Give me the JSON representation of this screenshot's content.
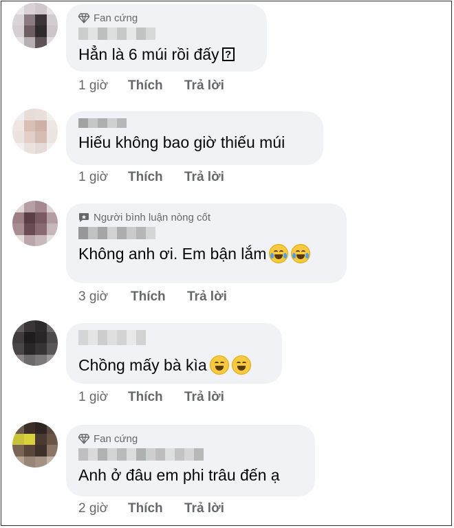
{
  "comments": [
    {
      "badge": "Fan cứng",
      "badge_icon": "diamond-icon",
      "text": "Hẳn là 6 múi rồi đấy",
      "trailing": "missing-glyph",
      "time": "1 giờ",
      "like": "Thích",
      "reply": "Trả lời"
    },
    {
      "badge": "",
      "text": "Hiếu không bao giờ thiếu múi",
      "time": "1 giờ",
      "like": "Thích",
      "reply": "Trả lời"
    },
    {
      "badge": "Người bình luận nòng cốt",
      "badge_icon": "chat-bubble-icon",
      "text": "Không anh ơi. Em bận lắm",
      "trailing": "laughing-tears-emoji",
      "time": "3 giờ",
      "like": "Thích",
      "reply": "Trả lời"
    },
    {
      "badge": "",
      "text": "Chồng mấy bà kìa",
      "trailing": "laughing-squint-emoji",
      "time": "1 giờ",
      "like": "Thích",
      "reply": "Trả lời"
    },
    {
      "badge": "Fan cứng",
      "badge_icon": "diamond-icon",
      "text": "Anh ở đâu em phi trâu đến ạ",
      "time": "2 giờ",
      "like": "Thích",
      "reply": "Trả lời"
    }
  ]
}
